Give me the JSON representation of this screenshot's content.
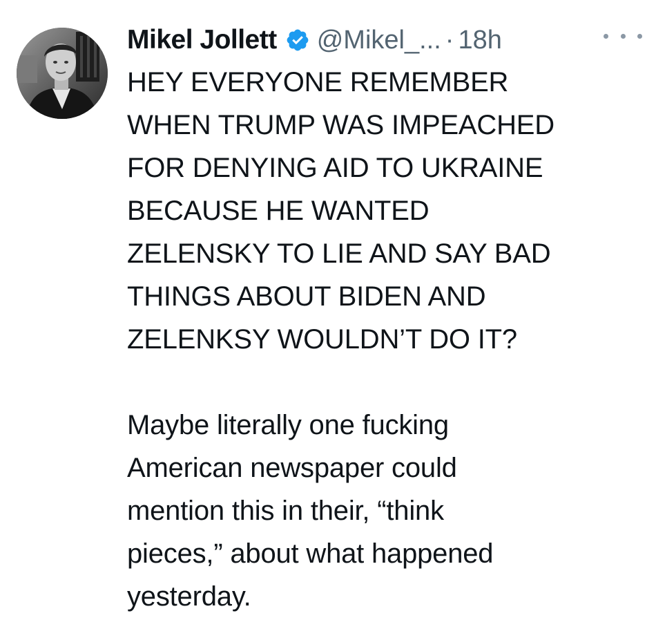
{
  "tweet": {
    "author": {
      "display_name": "Mikel Jollett",
      "handle": "@Mikel_...",
      "verified": true,
      "avatar_icon": "profile-photo-icon"
    },
    "separator": "·",
    "timestamp": "18h",
    "more_icon": "more-options-icon",
    "body": {
      "paragraph_1": [
        "HEY EVERYONE REMEMBER",
        "WHEN TRUMP WAS IMPEACHED",
        "FOR DENYING AID TO UKRAINE",
        "BECAUSE HE WANTED",
        "ZELENSKY TO LIE AND SAY BAD",
        "THINGS ABOUT BIDEN AND",
        "ZELENKSY WOULDN’T DO IT?"
      ],
      "paragraph_2": [
        "Maybe literally one fucking",
        "American newspaper could",
        "mention this in their, “think",
        "pieces,” about what happened",
        "yesterday."
      ]
    },
    "colors": {
      "text": "#0f1419",
      "secondary": "#536471",
      "verified_badge": "#1d9bf0"
    }
  }
}
